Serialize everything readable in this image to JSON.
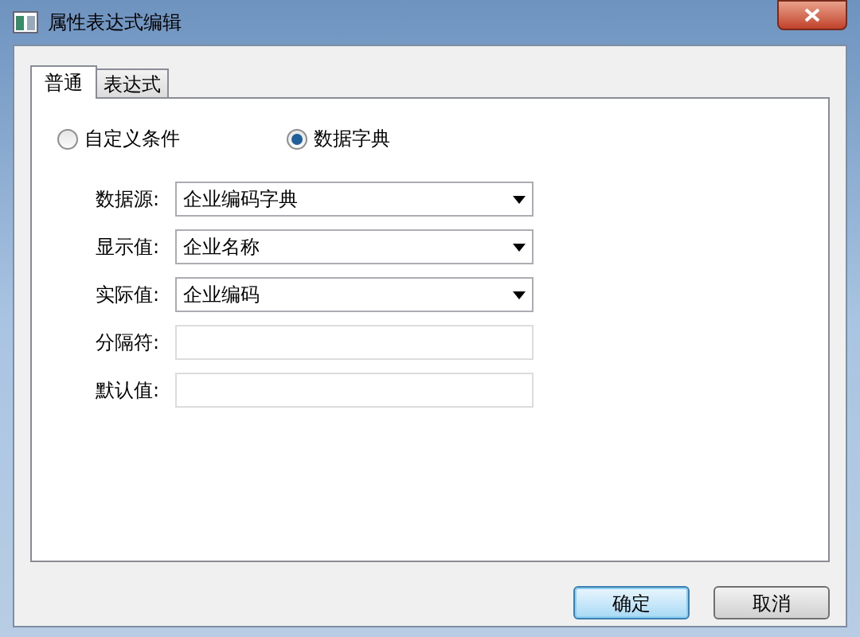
{
  "window": {
    "title": "属性表达式编辑"
  },
  "tabs": [
    {
      "label": "普通",
      "selected": true
    },
    {
      "label": "表达式",
      "selected": false
    }
  ],
  "mode": [
    {
      "label": "自定义条件",
      "selected": false
    },
    {
      "label": "数据字典",
      "selected": true
    }
  ],
  "fields": [
    {
      "label": "数据源:",
      "kind": "select",
      "value": "企业编码字典"
    },
    {
      "label": "显示值:",
      "kind": "select",
      "value": "企业名称"
    },
    {
      "label": "实际值:",
      "kind": "select",
      "value": "企业编码"
    },
    {
      "label": "分隔符:",
      "kind": "text"
    },
    {
      "label": "默认值:",
      "kind": "text"
    }
  ],
  "buttons": [
    {
      "label": "确定",
      "default": true
    },
    {
      "label": "取消",
      "default": false
    }
  ]
}
